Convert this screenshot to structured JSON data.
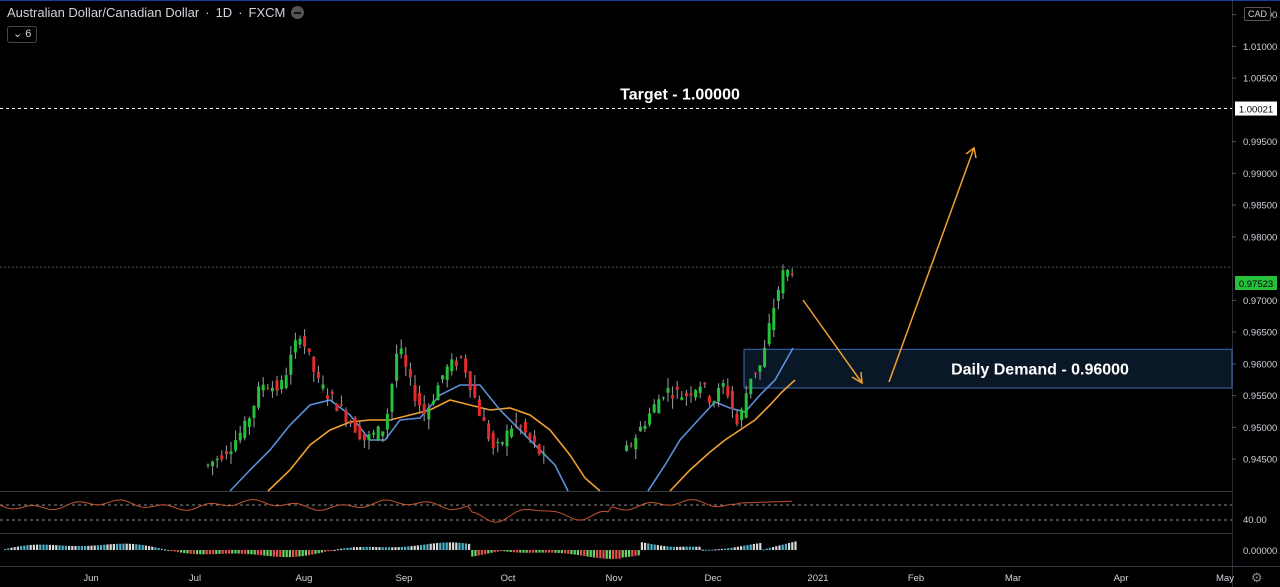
{
  "header": {
    "symbol": "Australian Dollar/Canadian Dollar",
    "interval": "1D",
    "source": "FXCM",
    "indicator_chip": "6"
  },
  "currency_badge": "CAD",
  "colors": {
    "background": "#000000",
    "up_candle": "#26c13a",
    "down_candle": "#e32b2b",
    "ma_fast": "#5b8fd9",
    "ma_slow": "#f0a030",
    "arrow": "#f0a030",
    "zone_border": "#3d6bb3",
    "zone_fill": "#0d1f33",
    "rsi_line": "#c2532f",
    "price_label_bg": "#ffffff"
  },
  "chart_data": {
    "type": "candlestick",
    "title": "Australian Dollar/Canadian Dollar · 1D · FXCM",
    "x_axis": {
      "labels": [
        "Jun",
        "Jul",
        "Aug",
        "Sep",
        "Oct",
        "Nov",
        "Dec",
        "2021",
        "Feb",
        "Mar",
        "Apr",
        "May"
      ]
    },
    "y_axis": {
      "ticks": [
        "1.01500",
        "1.01000",
        "1.00500",
        "0.99500",
        "0.99000",
        "0.98500",
        "0.98000",
        "0.97000",
        "0.96500",
        "0.96000",
        "0.95500",
        "0.95000",
        "0.94500"
      ],
      "range": [
        0.94,
        1.02
      ]
    },
    "current_price": "0.97523",
    "target_line_price": "1.00021",
    "annotations": [
      {
        "text": "Target - 1.00000",
        "price": 1.0
      },
      {
        "text": "Daily Demand - 0.96000",
        "zone": [
          0.9562,
          0.9623
        ]
      }
    ],
    "rsi_pane": {
      "level_label": "40.00"
    },
    "oscillator_pane": {
      "level_label": "0.00000"
    }
  }
}
